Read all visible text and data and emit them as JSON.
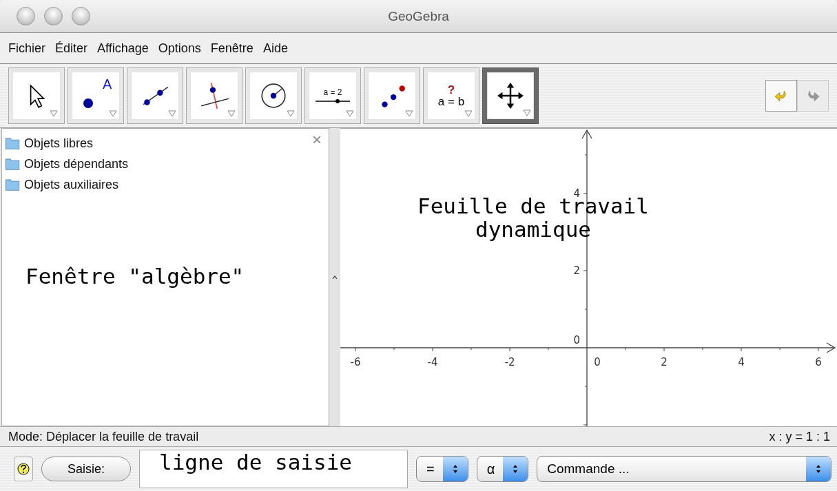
{
  "window": {
    "title": "GeoGebra"
  },
  "menu": [
    "Fichier",
    "Éditer",
    "Affichage",
    "Options",
    "Fenêtre",
    "Aide"
  ],
  "tools": [
    {
      "kind": "pointer",
      "selected": false
    },
    {
      "kind": "point",
      "label": "A",
      "selected": false
    },
    {
      "kind": "line",
      "selected": false
    },
    {
      "kind": "perpendicular",
      "selected": false
    },
    {
      "kind": "circle",
      "selected": false
    },
    {
      "kind": "slider",
      "label": "a = 2",
      "selected": false
    },
    {
      "kind": "reflect",
      "selected": false
    },
    {
      "kind": "relation",
      "mark": "?",
      "label": "a = b",
      "selected": false
    },
    {
      "kind": "move",
      "selected": true
    }
  ],
  "history": [
    {
      "kind": "undo",
      "disabled": false
    },
    {
      "kind": "redo",
      "disabled": true
    }
  ],
  "algebra": {
    "items": [
      "Objets libres",
      "Objets dépendants",
      "Objets auxiliaires"
    ],
    "close": "×",
    "note": "Fenêtre \"algèbre\""
  },
  "graphics": {
    "note": "Feuille de travail\ndynamique",
    "x_ticks": [
      "-6",
      "-4",
      "-2",
      "0",
      "2",
      "4",
      "6"
    ],
    "y_ticks": [
      "4",
      "2",
      "0"
    ]
  },
  "status_bar": {
    "mode": "Mode: Déplacer la feuille de travail",
    "ratio": "x : y = 1 : 1"
  },
  "input_bar": {
    "button": "Saisie:",
    "value": "ligne de saisie",
    "selects": [
      "=",
      "α",
      "Commande ..."
    ]
  }
}
